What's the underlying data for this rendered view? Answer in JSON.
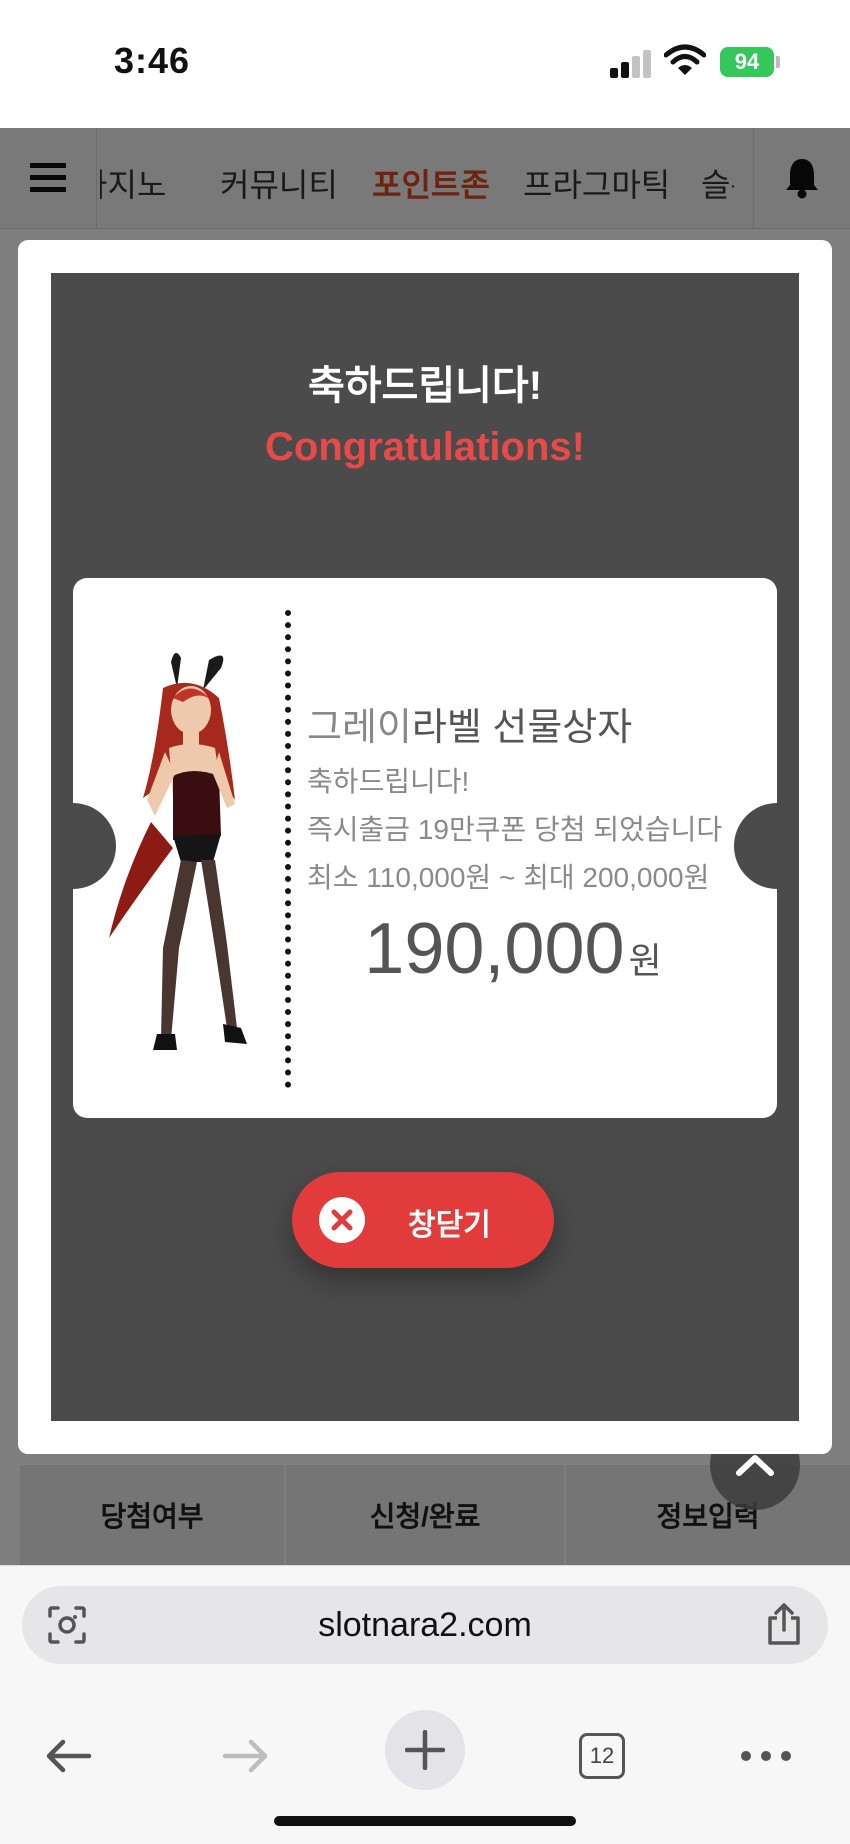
{
  "status_bar": {
    "time": "3:46",
    "battery": "94"
  },
  "nav": {
    "tabs": [
      "카지노",
      "커뮤니티",
      "포인트존",
      "프라그마틱",
      "슬롯"
    ],
    "active_tab": "포인트존"
  },
  "bottom_tabs": [
    "당첨여부",
    "신청/완료",
    "정보입력"
  ],
  "modal": {
    "title_ko": "축하드립니다!",
    "title_en": "Congratulations!",
    "ticket": {
      "item_title_highlight": "그레이",
      "item_title_rest": "라벨 선물상자",
      "line1": "축하드립니다!",
      "line2": "즉시출금 19만쿠폰 당첨 되었습니다",
      "line3": "최소 110,000원 ~ 최대 200,000원",
      "amount": "190,000",
      "unit": "원"
    },
    "close_label": "창닫기"
  },
  "browser": {
    "url": "slotnara2.com",
    "tab_count": "12"
  },
  "colors": {
    "accent": "#e23b3b",
    "active_tab": "#d8491f",
    "modal_bg": "#4b4b4b",
    "battery": "#34c759"
  }
}
